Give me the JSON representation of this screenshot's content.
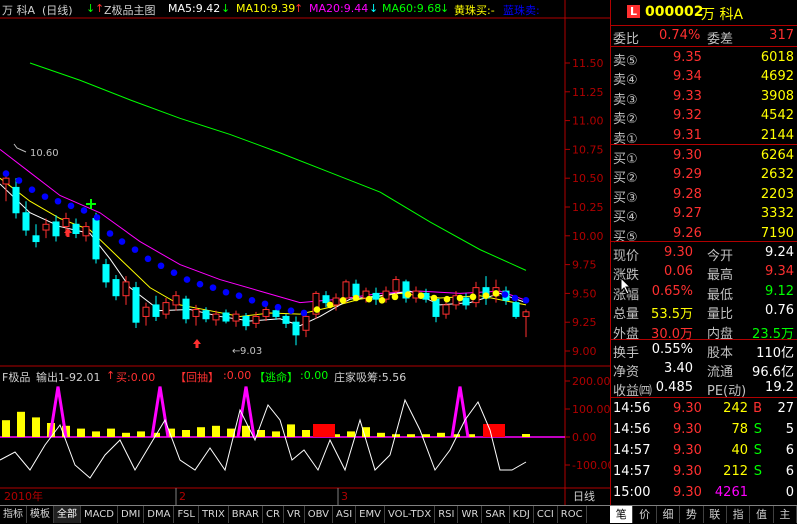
{
  "main_header": {
    "stock": "万 科A",
    "period": "(日线)",
    "indicator": "Z极品主图",
    "ma5": "MA5:9.42",
    "ma10": "MA10:9.39",
    "ma20": "MA20:9.44",
    "ma60": "MA60:9.68",
    "buy_label": "黄珠买:-",
    "sell_label": "蓝珠卖:"
  },
  "price_axis": [
    "11.50",
    "11.25",
    "11.00",
    "10.75",
    "10.50",
    "10.25",
    "10.00",
    "9.75",
    "9.50",
    "9.25",
    "9.00"
  ],
  "annotations": {
    "high": "10.60",
    "low": "9.03"
  },
  "sub_header": {
    "name": "F极品",
    "output": "输出1-92.01",
    "buy": "买:0.00",
    "return_label": "【回抽】",
    "return_val": ":0.00",
    "escape_label": "【逃命】",
    "escape_val": ":0.00",
    "absorb": "庄家吸筹:5.56"
  },
  "sub_axis": [
    "200.00",
    "100.00",
    "0.00",
    "-100.00"
  ],
  "time_axis": {
    "year": "2010年",
    "m2": "2",
    "m3": "3",
    "period_btn": "日线"
  },
  "bottom_tabs": [
    "指标",
    "模板",
    "全部",
    "MACD",
    "DMI",
    "DMA",
    "FSL",
    "TRIX",
    "BRAR",
    "CR",
    "VR",
    "OBV",
    "ASI",
    "EMV",
    "VOL-TDX",
    "RSI",
    "WR",
    "SAR",
    "KDJ",
    "CCI",
    "ROC"
  ],
  "side_tabs": [
    "笔",
    "价",
    "细",
    "势",
    "联",
    "指",
    "值",
    "主"
  ],
  "quote": {
    "badge": "L",
    "code": "000002",
    "name": "万 科A",
    "weibi_label": "委比",
    "weibi": "0.74%",
    "weicha_label": "委差",
    "weicha": "317",
    "asks": [
      {
        "label": "卖⑤",
        "price": "9.35",
        "vol": "6018"
      },
      {
        "label": "卖④",
        "price": "9.34",
        "vol": "4692"
      },
      {
        "label": "卖③",
        "price": "9.33",
        "vol": "3908"
      },
      {
        "label": "卖②",
        "price": "9.32",
        "vol": "4542"
      },
      {
        "label": "卖①",
        "price": "9.31",
        "vol": "2144"
      }
    ],
    "bids": [
      {
        "label": "买①",
        "price": "9.30",
        "vol": "6264"
      },
      {
        "label": "买②",
        "price": "9.29",
        "vol": "2632"
      },
      {
        "label": "买③",
        "price": "9.28",
        "vol": "2203"
      },
      {
        "label": "买④",
        "price": "9.27",
        "vol": "3332"
      },
      {
        "label": "买⑤",
        "price": "9.26",
        "vol": "7190"
      }
    ],
    "stats": [
      {
        "l1": "现价",
        "v1": "9.30",
        "c1": "#ff3030",
        "l2": "今开",
        "v2": "9.24",
        "c2": "#ffffff"
      },
      {
        "l1": "涨跌",
        "v1": "0.06",
        "c1": "#ff3030",
        "l2": "最高",
        "v2": "9.34",
        "c2": "#ff3030"
      },
      {
        "l1": "涨幅",
        "v1": "0.65%",
        "c1": "#ff3030",
        "l2": "最低",
        "v2": "9.12",
        "c2": "#00ff00"
      },
      {
        "l1": "总量",
        "v1": "53.5万",
        "c1": "#ffff00",
        "l2": "量比",
        "v2": "0.76",
        "c2": "#ffffff"
      },
      {
        "l1": "外盘",
        "v1": "30.0万",
        "c1": "#ff3030",
        "l2": "内盘",
        "v2": "23.5万",
        "c2": "#00ff00"
      }
    ],
    "fund": [
      {
        "l1": "换手",
        "v1": "0.55%",
        "l2": "股本",
        "v2": "110亿"
      },
      {
        "l1": "净资",
        "v1": "3.40",
        "l2": "流通",
        "v2": "96.6亿"
      },
      {
        "l1": "收益㈣",
        "v1": "0.485",
        "l2": "PE(动)",
        "v2": "19.2"
      }
    ],
    "ticks": [
      {
        "time": "14:56",
        "price": "9.30",
        "vol": "242",
        "flag": "B",
        "flag_color": "#ff3030",
        "n": "27",
        "vol_color": "#ffff00"
      },
      {
        "time": "14:56",
        "price": "9.30",
        "vol": "78",
        "flag": "S",
        "flag_color": "#00ff00",
        "n": "5",
        "vol_color": "#ffff00"
      },
      {
        "time": "14:57",
        "price": "9.30",
        "vol": "40",
        "flag": "S",
        "flag_color": "#00ff00",
        "n": "6",
        "vol_color": "#ffff00"
      },
      {
        "time": "14:57",
        "price": "9.30",
        "vol": "212",
        "flag": "S",
        "flag_color": "#00ff00",
        "n": "6",
        "vol_color": "#ffff00"
      },
      {
        "time": "15:00",
        "price": "9.30",
        "vol": "4261",
        "flag": "",
        "flag_color": "#ff3030",
        "n": "0",
        "vol_color": "#ff00ff"
      }
    ]
  },
  "colors": {
    "up": "#ff3030",
    "down": "#00ffff",
    "ma5": "#ffffff",
    "ma10": "#ffff00",
    "ma20": "#ff00ff",
    "ma60": "#00ff00",
    "grid": "#b00000"
  }
}
